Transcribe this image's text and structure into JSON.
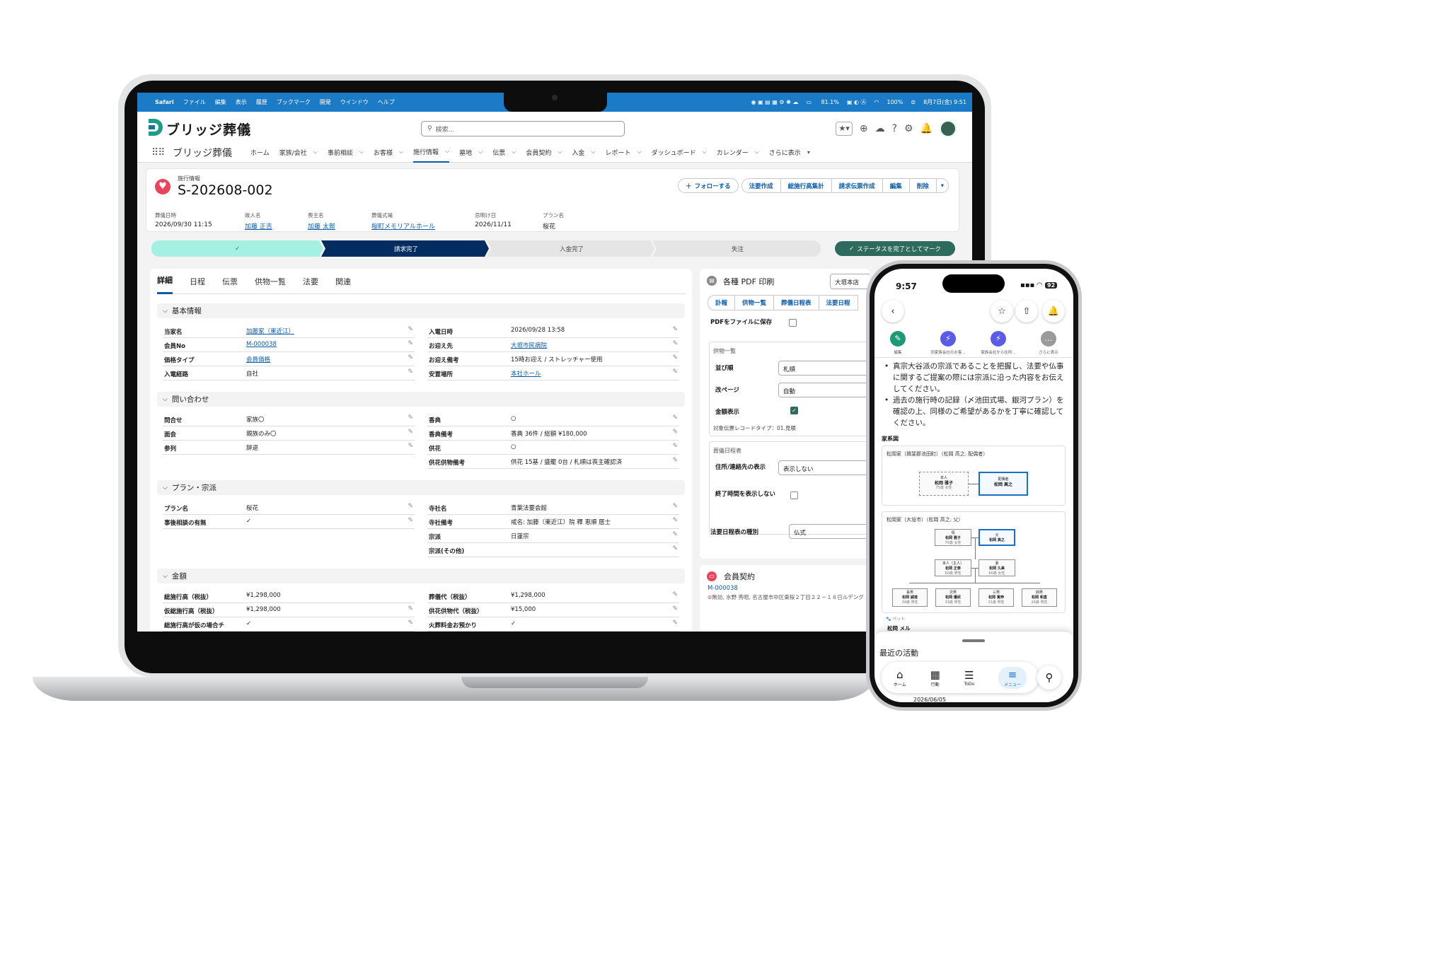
{
  "menubar": {
    "apple": "",
    "items": [
      "Safari",
      "ファイル",
      "編集",
      "表示",
      "履歴",
      "ブックマーク",
      "開発",
      "ウインドウ",
      "ヘルプ"
    ],
    "battery": "81.1%",
    "zoom": "100%",
    "datetime": "8月7日(金) 9:51"
  },
  "header": {
    "logo_text": "ブリッジ葬儀",
    "search_placeholder": "検索..."
  },
  "nav": {
    "app_name": "ブリッジ葬儀",
    "items": [
      "ホーム",
      "家族/会社",
      "事前相談",
      "お客様",
      "施行情報",
      "墓地",
      "伝票",
      "会員契約",
      "入金",
      "レポート",
      "ダッシュボード",
      "カレンダー"
    ],
    "more": "さらに表示"
  },
  "record": {
    "type": "施行情報",
    "title": "S-202608-002",
    "buttons": [
      "フォローする",
      "法要作成",
      "総施行高集計",
      "請求伝票作成",
      "編集",
      "削除"
    ],
    "highlights": [
      {
        "label": "葬儀日時",
        "value": "2026/09/30 11:15",
        "link": false
      },
      {
        "label": "故人名",
        "value": "加藤 正吉",
        "link": true
      },
      {
        "label": "喪主名",
        "value": "加藤 太郎",
        "link": true
      },
      {
        "label": "葬儀式場",
        "value": "桜町メモリアルホール",
        "link": true
      },
      {
        "label": "忌明け日",
        "value": "2026/11/11",
        "link": false
      },
      {
        "label": "プラン名",
        "value": "桜花",
        "link": false
      }
    ]
  },
  "path": {
    "steps": [
      "✓",
      "請求完了",
      "入金完了",
      "失注"
    ],
    "complete_label": "ステータスを完了としてマーク"
  },
  "detail": {
    "tabs": [
      "詳細",
      "日程",
      "伝票",
      "供物一覧",
      "法要",
      "関連"
    ],
    "sections": {
      "basic": "基本情報",
      "inquiry": "問い合わせ",
      "plan": "プラン・宗派",
      "amount": "金額"
    },
    "basic_left": [
      {
        "label": "当家名",
        "value": "加藤家（東近江）",
        "link": true
      },
      {
        "label": "会員No",
        "value": "M-000038",
        "link": true
      },
      {
        "label": "価格タイプ",
        "value": "会員価格",
        "link": true
      },
      {
        "label": "入電経路",
        "value": "自社",
        "link": false
      }
    ],
    "basic_right": [
      {
        "label": "入電日時",
        "value": "2026/09/28 13:58",
        "link": false
      },
      {
        "label": "お迎え先",
        "value": "大垣市民病院",
        "link": true
      },
      {
        "label": "お迎え備考",
        "value": "15時お迎え / ストレッチャー使用",
        "link": false
      },
      {
        "label": "安置場所",
        "value": "本社ホール",
        "link": true
      }
    ],
    "inquiry_left": [
      {
        "label": "問合せ",
        "value": "家族〇"
      },
      {
        "label": "面会",
        "value": "親族のみ〇"
      },
      {
        "label": "参列",
        "value": "辞退"
      }
    ],
    "inquiry_right": [
      {
        "label": "香典",
        "value": "○"
      },
      {
        "label": "香典備考",
        "value": "香典 36件 / 総額 ¥180,000"
      },
      {
        "label": "供花",
        "value": "○"
      },
      {
        "label": "供花供物備考",
        "value": "供花 15基 / 盛籠 0台 / 札順は喪主確認済"
      }
    ],
    "plan_left": [
      {
        "label": "プラン名",
        "value": "桜花"
      },
      {
        "label": "事後相談の有無",
        "value": "✓"
      }
    ],
    "plan_right": [
      {
        "label": "寺社名",
        "value": "青葉法要会館"
      },
      {
        "label": "寺社備考",
        "value": "戒名: 加藤（東近江）院 釋 恵順 居士"
      },
      {
        "label": "宗派",
        "value": "日蓮宗"
      },
      {
        "label": "宗派(その他)",
        "value": ""
      }
    ],
    "amount_left": [
      {
        "label": "総施行高（税抜）",
        "value": "¥1,298,000"
      },
      {
        "label": "仮総施行高（税抜）",
        "value": "¥1,298,000"
      },
      {
        "label": "総施行高が仮の場合チ",
        "value": "✓"
      }
    ],
    "amount_right": [
      {
        "label": "葬儀代（税抜）",
        "value": "¥1,298,000"
      },
      {
        "label": "供花供物代（税抜）",
        "value": "¥15,000"
      },
      {
        "label": "火葬料金お預かり",
        "value": "✓"
      }
    ]
  },
  "pdf": {
    "title": "各種 PDF 印刷",
    "store": "大垣本店",
    "tabs": [
      "訃報",
      "供物一覧",
      "葬儀日程表",
      "法要日程"
    ],
    "save_label": "PDFをファイルに保存",
    "section1": "供物一覧",
    "order_label": "並び順",
    "order_value": "札順",
    "page_label": "改ページ",
    "page_value": "自動",
    "amount_label": "金額表示",
    "target_label": "対象伝票レコードタイプ：01.見積",
    "section2": "葬儀日程表",
    "addr_label": "住所/連絡先の表示",
    "addr_value": "表示しない",
    "endtime_label": "終了時間を表示しない",
    "hoyo_label": "法要日程表の種別",
    "hoyo_value": "仏式"
  },
  "member": {
    "title": "会員契約",
    "number": "M-000038",
    "detail": "無効, 水野 秀昭, 名古屋市中区東桜２丁目２２－１８日ルデング"
  },
  "phone": {
    "time": "9:57",
    "battery": "92",
    "quick_actions": [
      {
        "label": "編集",
        "color": "#1e9b76",
        "icon": "✎"
      },
      {
        "label": "同家族会社のお客...",
        "color": "#5b5ce6",
        "icon": "⚡"
      },
      {
        "label": "家族会社から住所...",
        "color": "#5b5ce6",
        "icon": "⚡"
      },
      {
        "label": "さらに表示",
        "color": "#9a9a9a",
        "icon": "…"
      }
    ],
    "bullets": [
      "真宗大谷派の宗派であることを把握し、法要や仏事に関するご提案の際には宗派に沿った内容をお伝えしてください。",
      "過去の施行時の記録（〆池田式場、銀河プラン）を確認の上、同様のご希望があるかを丁寧に確認してください。"
    ],
    "family_title": "家系図",
    "tree1_title": "松岡家（揖斐郡池田町）（松岡 高之: 配偶者）",
    "tree1_person1_role": "本人",
    "tree1_person1_name": "松岡 雅子",
    "tree1_person1_note": "75歳 女性",
    "tree1_person2_role": "配偶者",
    "tree1_person2_name": "松岡 高之",
    "tree2_title": "松岡家（大垣市）（松岡 高之: 父）",
    "tree2_mother_role": "母",
    "tree2_mother_name": "松岡 雅子",
    "tree2_mother_note": "75歳 女性",
    "tree2_father_role": "父",
    "tree2_father_name": "松岡 高之",
    "tree2_self_role": "本人（主人）",
    "tree2_self_name": "松岡 正泰",
    "tree2_self_note": "60歳 男性",
    "tree2_wife_role": "妻",
    "tree2_wife_name": "松岡 久美",
    "tree2_wife_note": "60歳 女性",
    "tree2_kids": [
      {
        "role": "長男",
        "name": "松岡 誠道",
        "note": "34歳 男性"
      },
      {
        "role": "次男",
        "name": "松岡 優武",
        "note": "33歳 男性"
      },
      {
        "role": "三男",
        "name": "松岡 寛伸",
        "note": "31歳 男性"
      },
      {
        "role": "四男",
        "name": "松岡 和直",
        "note": "26歳 男性"
      }
    ],
    "pet_label": "ペット",
    "pet_name": "松岡 メル",
    "recent_title": "最近の活動",
    "recent_date": "2026/06/05",
    "tabbar": [
      "ホーム",
      "行動",
      "ToDo",
      "メニュー"
    ]
  }
}
